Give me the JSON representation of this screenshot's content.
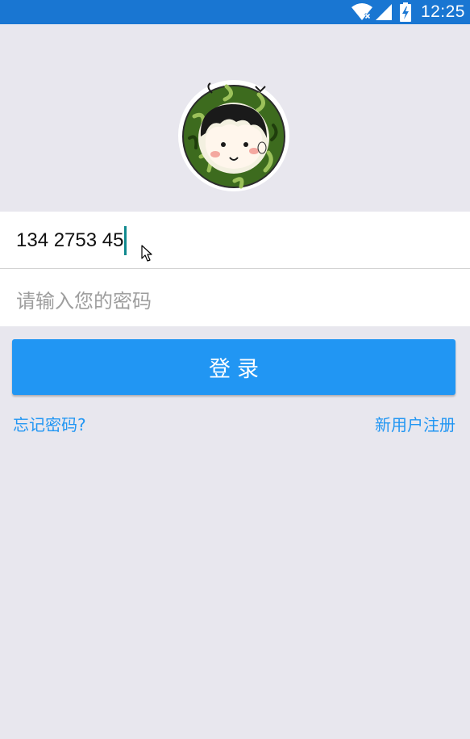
{
  "status_bar": {
    "time": "12:25",
    "color": "#1976d2",
    "icons": [
      "wifi-icon",
      "signal-icon",
      "battery-charging-icon"
    ]
  },
  "avatar": {
    "icon": "watermelon-boy-avatar"
  },
  "phone_field": {
    "value": "134 2753 45",
    "caret_color": "#10898e"
  },
  "password_field": {
    "placeholder": "请输入您的密码",
    "value": ""
  },
  "login_button": {
    "label": "登录",
    "color": "#2196f3"
  },
  "links": {
    "forgot_password": "忘记密码?",
    "register": "新用户注册",
    "color": "#2196f3"
  },
  "background_color": "#e8e7ee"
}
